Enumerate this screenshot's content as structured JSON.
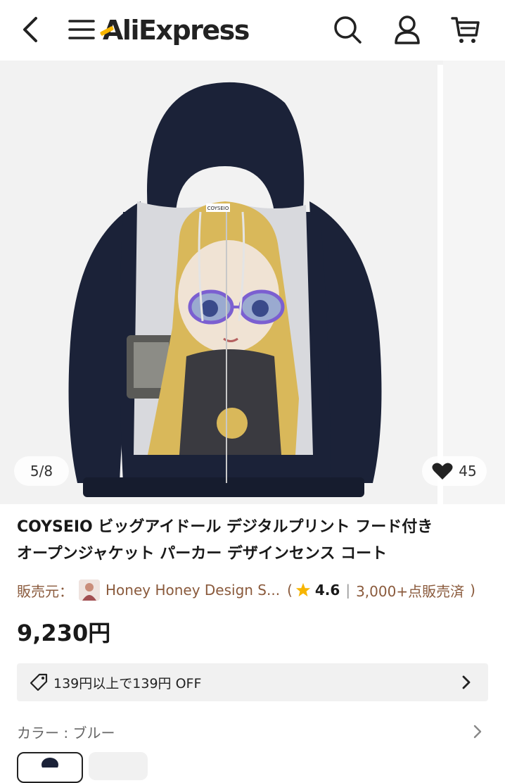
{
  "header": {
    "logo_text": "AliExpress",
    "icons": [
      "back-icon",
      "menu-icon",
      "search-icon",
      "user-icon",
      "cart-icon"
    ]
  },
  "gallery": {
    "counter": "5/8",
    "likes": "45",
    "image_brand_tag": "COYSEIO"
  },
  "product": {
    "title_line1": "COYSEIO ビッグアイドール デジタルプリント フード付き",
    "title_line2": "オープンジャケット パーカー デザインセンス コート",
    "price": "9,230円"
  },
  "seller": {
    "label": "販売元：",
    "name": "Honey Honey Design S...",
    "paren_open": "(",
    "rating": "4.6",
    "divider": "|",
    "sold": "3,000+点販売済",
    "paren_close": ")"
  },
  "coupon": {
    "text": "139円以上で139円 OFF"
  },
  "color": {
    "label": "カラー : ブルー"
  },
  "colors": {
    "star": "#f7b500",
    "seller_link": "#8a5a3c",
    "hoodie_navy": "#1b2238"
  }
}
